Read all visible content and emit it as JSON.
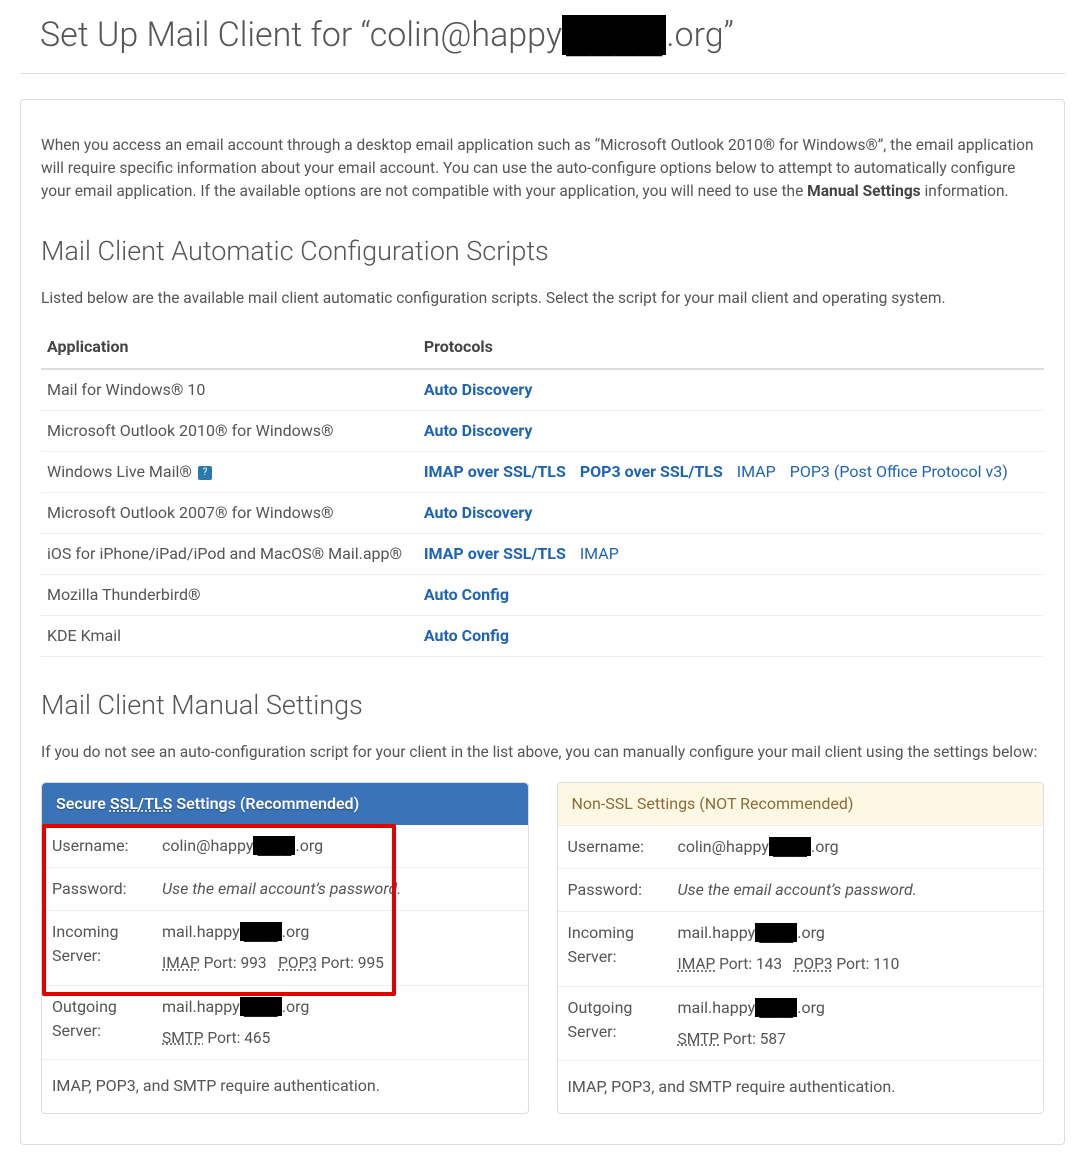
{
  "title_prefix": "Set Up Mail Client for “colin@happy",
  "title_redacted": "████",
  "title_suffix": ".org”",
  "intro_before_bold": "When you access an email account through a desktop email application such as “Microsoft Outlook 2010® for Windows®”, the email application will require specific information about your email account. You can use the auto-configure options below to attempt to automatically configure your email application. If the available options are not compatible with your application, you will need to use the ",
  "intro_bold": "Manual Settings",
  "intro_after_bold": " information.",
  "auto_heading": "Mail Client Automatic Configuration Scripts",
  "auto_sub": "Listed below are the available mail client automatic configuration scripts. Select the script for your mail client and operating system.",
  "table": {
    "col1": "Application",
    "col2": "Protocols"
  },
  "rows": [
    {
      "app": "Mail for Windows® 10",
      "links": [
        {
          "t": "Auto Discovery",
          "strong": true
        }
      ]
    },
    {
      "app": "Microsoft Outlook 2010® for Windows®",
      "links": [
        {
          "t": "Auto Discovery",
          "strong": true
        }
      ]
    },
    {
      "app": "Windows Live Mail®",
      "help": true,
      "links": [
        {
          "t": "IMAP over SSL/TLS",
          "strong": true
        },
        {
          "t": "POP3 over SSL/TLS",
          "strong": true
        },
        {
          "t": "IMAP",
          "strong": false
        },
        {
          "t": "POP3 (Post Office Protocol v3)",
          "strong": false
        }
      ]
    },
    {
      "app": "Microsoft Outlook 2007® for Windows®",
      "links": [
        {
          "t": "Auto Discovery",
          "strong": true
        }
      ]
    },
    {
      "app": "iOS for iPhone/iPad/iPod and MacOS® Mail.app®",
      "links": [
        {
          "t": "IMAP over SSL/TLS",
          "strong": true
        },
        {
          "t": "IMAP",
          "strong": false
        }
      ]
    },
    {
      "app": "Mozilla Thunderbird®",
      "links": [
        {
          "t": "Auto Config",
          "strong": true
        }
      ]
    },
    {
      "app": "KDE Kmail",
      "links": [
        {
          "t": "Auto Config",
          "strong": true
        }
      ]
    }
  ],
  "manual_heading": "Mail Client Manual Settings",
  "manual_sub": "If you do not see an auto-configuration script for your client in the list above, you can manually configure your mail client using the settings below:",
  "ssl": {
    "header_prefix": "Secure ",
    "header_abbr": "SSL/TLS",
    "header_suffix": " Settings (Recommended)",
    "username_label": "Username:",
    "username_prefix": "colin@happy",
    "username_suffix": ".org",
    "password_label": "Password:",
    "password_value": "Use the email account’s password.",
    "incoming_label": "Incoming Server:",
    "incoming_prefix": "mail.happy",
    "incoming_suffix": ".org",
    "imap_label": "IMAP",
    "imap_port_text": " Port: 993",
    "pop3_label": "POP3",
    "pop3_port_text": " Port: 995",
    "outgoing_label": "Outgoing Server:",
    "outgoing_prefix": "mail.happy",
    "outgoing_suffix": ".org",
    "smtp_label": "SMTP",
    "smtp_port_text": " Port: 465",
    "footer": "IMAP, POP3, and SMTP require authentication."
  },
  "nonssl": {
    "header": "Non-SSL Settings (NOT Recommended)",
    "username_label": "Username:",
    "username_prefix": "colin@happy",
    "username_suffix": ".org",
    "password_label": "Password:",
    "password_value": "Use the email account’s password.",
    "incoming_label": "Incoming Server:",
    "incoming_prefix": "mail.happy",
    "incoming_suffix": ".org",
    "imap_label": "IMAP",
    "imap_port_text": " Port: 143",
    "pop3_label": "POP3",
    "pop3_port_text": " Port: 110",
    "outgoing_label": "Outgoing Server:",
    "outgoing_prefix": "mail.happy",
    "outgoing_suffix": ".org",
    "smtp_label": "SMTP",
    "smtp_port_text": " Port: 587",
    "footer": "IMAP, POP3, and SMTP require authentication."
  }
}
